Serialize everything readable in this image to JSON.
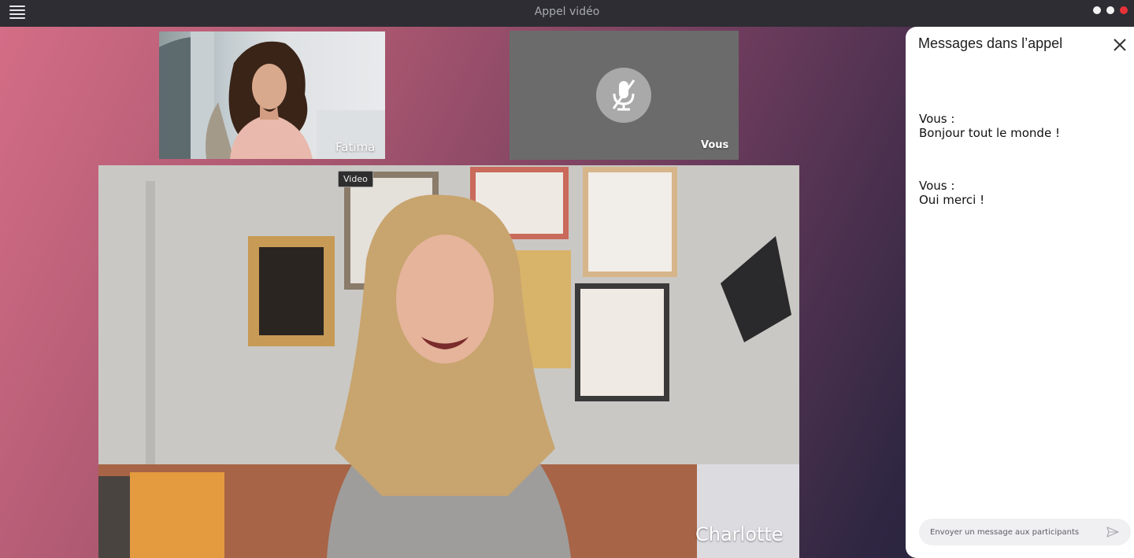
{
  "window": {
    "title": "Appel vidéo",
    "icons": {
      "menu": "hamburger-menu-icon",
      "controls": [
        "white-dot",
        "white-dot",
        "red-dot"
      ]
    }
  },
  "participants": {
    "fatima": {
      "name": "Fatima"
    },
    "you": {
      "name": "Vous",
      "muted_icon": "microphone-muted-icon"
    },
    "main": {
      "name": "Charlotte"
    }
  },
  "tooltip": {
    "text": "Video"
  },
  "chat": {
    "title": "Messages dans l’appel",
    "close_icon": "close-icon",
    "messages": [
      {
        "author": "Vous :",
        "text": "Bonjour tout le monde !"
      },
      {
        "author": "Vous :",
        "text": "Oui merci !"
      }
    ],
    "input_placeholder": "Envoyer un message aux participants",
    "send_icon": "send-icon"
  },
  "colors": {
    "accent_close": "#e8323a",
    "gradient_start": "#d46d86",
    "gradient_end": "#1d1f38",
    "muted_tile": "#6b6b6b"
  }
}
